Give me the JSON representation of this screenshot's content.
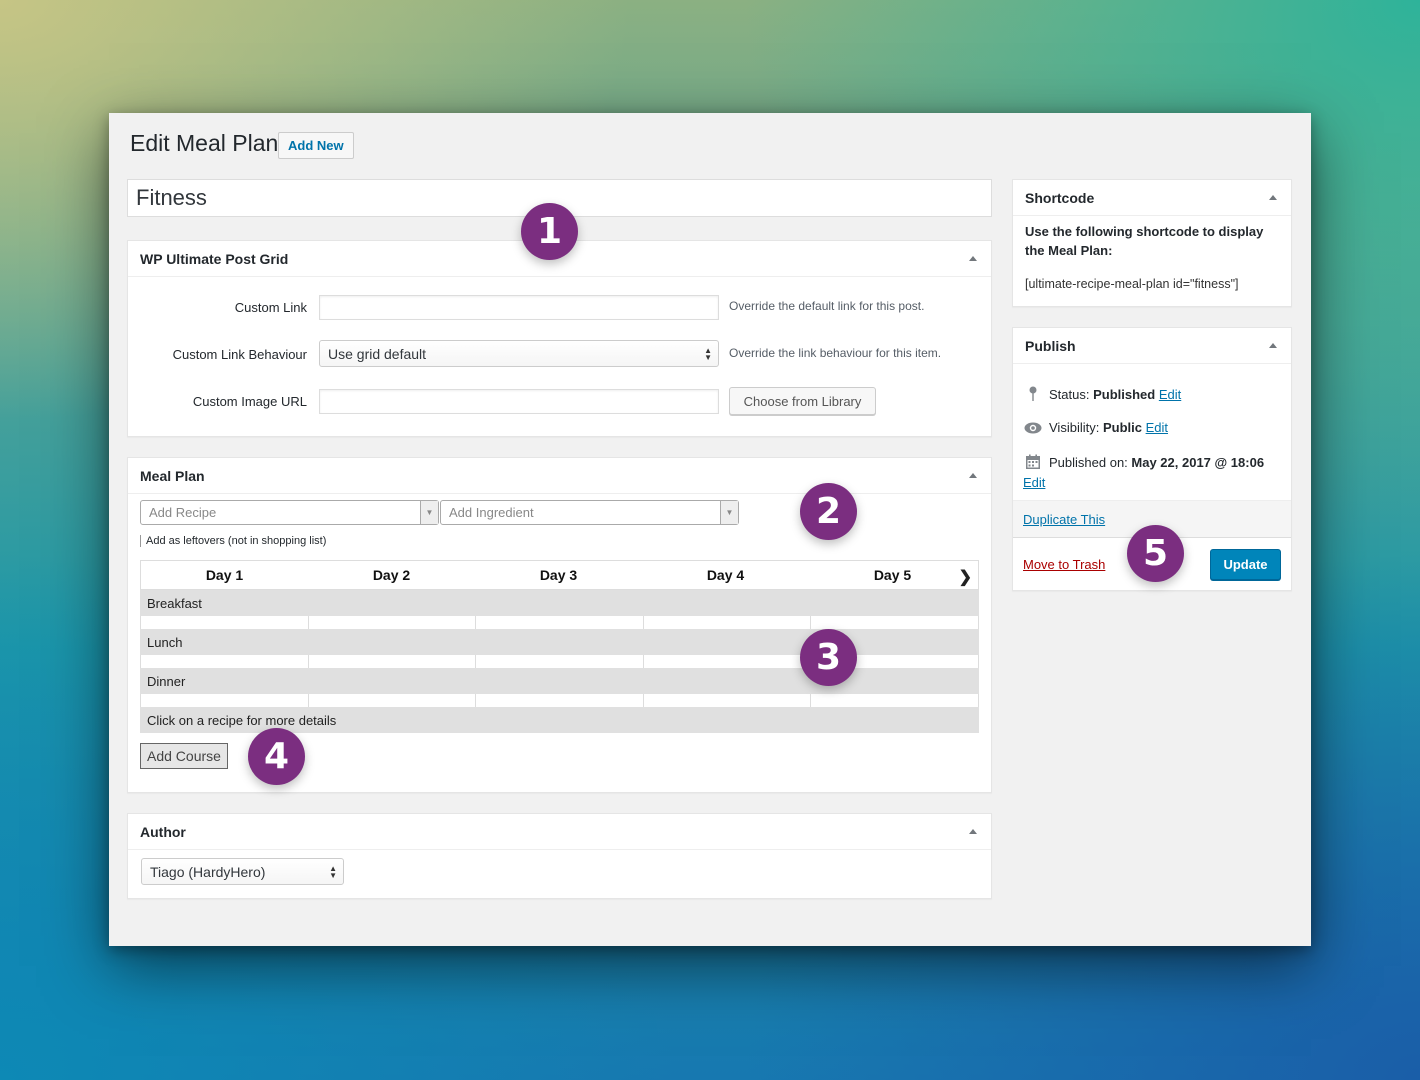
{
  "header": {
    "title": "Edit Meal Plan",
    "add_new": "Add New"
  },
  "post_title": "Fitness",
  "post_grid": {
    "title": "WP Ultimate Post Grid",
    "custom_link_label": "Custom Link",
    "custom_link_value": "",
    "custom_link_help": "Override the default link for this post.",
    "link_behaviour_label": "Custom Link Behaviour",
    "link_behaviour_value": "Use grid default",
    "link_behaviour_help": "Override the link behaviour for this item.",
    "image_url_label": "Custom Image URL",
    "image_url_value": "",
    "choose_library": "Choose from Library"
  },
  "meal_plan": {
    "title": "Meal Plan",
    "add_recipe_placeholder": "Add Recipe",
    "add_ingredient_placeholder": "Add Ingredient",
    "leftovers": "Add as leftovers (not in shopping list)",
    "days": [
      "Day 1",
      "Day 2",
      "Day 3",
      "Day 4",
      "Day 5"
    ],
    "courses": [
      "Breakfast",
      "Lunch",
      "Dinner"
    ],
    "footer_note": "Click on a recipe for more details",
    "add_course": "Add Course"
  },
  "author": {
    "title": "Author",
    "value": "Tiago (HardyHero)"
  },
  "shortcode": {
    "title": "Shortcode",
    "description": "Use the following shortcode to display the Meal Plan:",
    "code": "[ultimate-recipe-meal-plan id=\"fitness\"]"
  },
  "publish": {
    "title": "Publish",
    "status_label": "Status:",
    "status_value": "Published",
    "visibility_label": "Visibility:",
    "visibility_value": "Public",
    "published_label": "Published on:",
    "published_value": "May 22, 2017 @ 18:06",
    "edit": "Edit",
    "duplicate": "Duplicate This",
    "trash": "Move to Trash",
    "update": "Update"
  },
  "badges": [
    "1",
    "2",
    "3",
    "4",
    "5"
  ],
  "colors": {
    "badge": "#7b2e80",
    "link": "#0073aa",
    "trash": "#a00",
    "primary_button": "#0085ba"
  }
}
